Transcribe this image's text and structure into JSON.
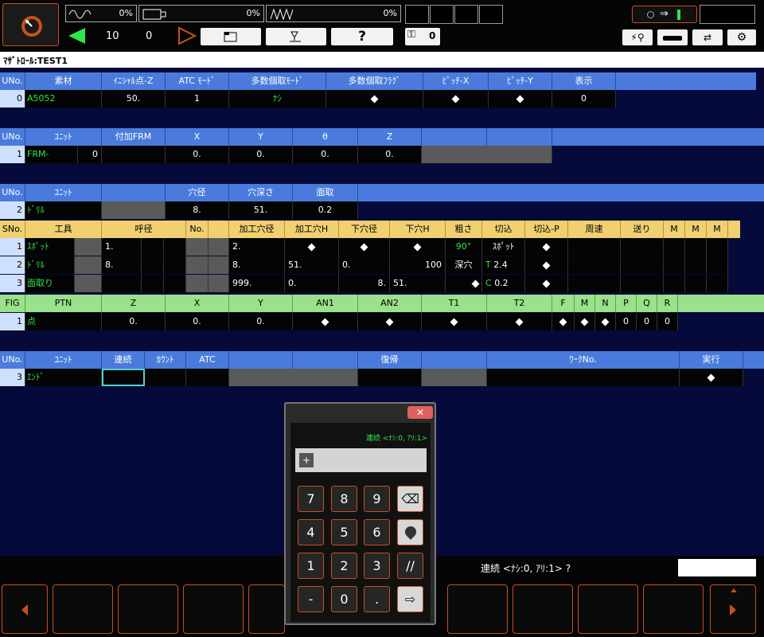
{
  "top": {
    "meter1_pct": "0%",
    "meter2_pct": "0%",
    "meter3_pct": "0%",
    "counter_a": "10",
    "counter_b": "0",
    "key_count": "0",
    "help_label": "?"
  },
  "program": {
    "title": "ﾏｻﾞﾄﾛｰﾙ:TEST1"
  },
  "material": {
    "headers": [
      "UNo.",
      "素材",
      "ｲﾆｼｬﾙ点-Z",
      "ATC ﾓｰﾄﾞ",
      "多数個取ﾓｰﾄﾞ",
      "多数個取ﾌﾗｸﾞ",
      "ﾋﾟｯﾁ-X",
      "ﾋﾟｯﾁ-Y",
      "表示"
    ],
    "row": {
      "uno": "0",
      "material": "A5052",
      "initial_z": "50.",
      "atc_mode": "1",
      "multi_mode": "ﾅｼ",
      "display": "0"
    }
  },
  "unit1": {
    "headers": [
      "UNo.",
      "ﾕﾆｯﾄ",
      "付加FRM",
      "X",
      "Y",
      "θ",
      "Z"
    ],
    "row": {
      "uno": "1",
      "unit": "FRM-",
      "unit_val": "0",
      "x": "0.",
      "y": "0.",
      "theta": "0.",
      "z": "0."
    }
  },
  "unit2": {
    "headers": [
      "UNo.",
      "ﾕﾆｯﾄ",
      "穴径",
      "穴深さ",
      "面取"
    ],
    "row": {
      "uno": "2",
      "unit": "ﾄﾞﾘﾙ",
      "dia": "8.",
      "depth": "51.",
      "chamfer": "0.2"
    }
  },
  "tools": {
    "headers": [
      "SNo.",
      "工具",
      "呼径",
      "No.",
      "加工穴径",
      "加工穴H",
      "下穴径",
      "下穴H",
      "粗さ",
      "切込",
      "切込-P",
      "周速",
      "送り",
      "M",
      "M",
      "M"
    ],
    "rows": [
      {
        "sno": "1",
        "tool": "ｽﾎﾟｯﾄ",
        "nom": "1.",
        "hole_dia": "2.",
        "hole_h": "",
        "pre_dia": "",
        "pre_h": "",
        "rough": "90°",
        "cut": "ｽﾎﾟｯﾄ",
        "cut_p": ""
      },
      {
        "sno": "2",
        "tool": "ﾄﾞﾘﾙ",
        "nom": "8.",
        "hole_dia": "8.",
        "hole_h": "51.",
        "pre_dia": "0.",
        "pre_h": "100",
        "rough": "深穴",
        "cut": "2.4",
        "cut_tag": "T",
        "cut_p": ""
      },
      {
        "sno": "3",
        "tool": "面取り",
        "nom": "",
        "hole_dia": "999.",
        "hole_h": "0.",
        "pre_dia": "8.",
        "pre_h": "51.",
        "rough": "",
        "cut": "0.2",
        "cut_tag": "C",
        "cut_p": ""
      }
    ]
  },
  "fig": {
    "headers": [
      "FIG",
      "PTN",
      "Z",
      "X",
      "Y",
      "AN1",
      "AN2",
      "T1",
      "T2",
      "F",
      "M",
      "N",
      "P",
      "Q",
      "R"
    ],
    "row": {
      "fig": "1",
      "ptn": "点",
      "z": "0.",
      "x": "0.",
      "y": "0.",
      "p": "0",
      "q": "0",
      "r": "0"
    }
  },
  "unit3": {
    "headers": [
      "UNo.",
      "ﾕﾆｯﾄ",
      "連続",
      "ｶｳﾝﾄ",
      "ATC",
      "復帰",
      "ﾜｰｸNo.",
      "実行"
    ],
    "row": {
      "uno": "3",
      "unit": "ｴﾝﾄﾞ"
    }
  },
  "message": {
    "prompt": "連続 <ﾅｼ:0, ｱﾘ:1> ?"
  },
  "keypad": {
    "hint": "連続 <ﾅｼ:0, ｱﾘ:1>",
    "plus": "+",
    "keys": [
      "7",
      "8",
      "9",
      "4",
      "5",
      "6",
      "1",
      "2",
      "3",
      "-",
      "0",
      "."
    ]
  },
  "colors": {
    "accent": "#c8501e",
    "header_blue": "#4a7bdc",
    "header_yellow": "#f0d070",
    "header_green": "#9be08a",
    "label_green": "#2ee64a"
  }
}
